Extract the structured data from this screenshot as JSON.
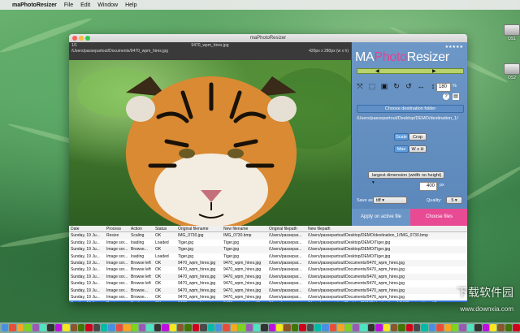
{
  "menubar": {
    "app": "maPhotoResizer",
    "items": [
      "File",
      "Edit",
      "Window",
      "Help"
    ]
  },
  "desktop": {
    "icons": [
      "OS1",
      "OS2"
    ]
  },
  "window": {
    "title": "maPhotoResizer",
    "info": {
      "count": "1/1",
      "path": "/Users/passepartout/Documents/9470_wpm_hires.jpg",
      "filename": "9470_wpm_hires.jpg",
      "dims": "420px x 280px (w x h)"
    },
    "logo": {
      "prefix": "MA",
      "brand": "Photo",
      "suffix": "Resizer"
    },
    "stars": "★★★★★",
    "zoom": "180",
    "zoom_unit": "%",
    "choose_dest_label": "Choose destination folder",
    "dest_path": "/Users/passepartout/Desktop/DEMO/destination_1/",
    "scale_label": "Scale",
    "crop_label": "Crop",
    "max_label": "Max",
    "wxh_label": "W x H",
    "dimension_select": "largest dimension (width no height)",
    "dimension_value": "400",
    "dimension_unit": "px",
    "save_as_label": "Save as:",
    "save_as_value": "tiff",
    "quality_label": "Quality:",
    "quality_value": "5",
    "apply_label": "Apply on active file",
    "choose_files_label": "Choose files"
  },
  "table": {
    "headers": [
      "Date",
      "Process",
      "Action",
      "Status",
      "Original filename",
      "New filename",
      "Original filepath",
      "New filepath"
    ],
    "rows": [
      [
        "Sunday, 19 Ju...",
        "Resize",
        "Scaling",
        "OK",
        "IMG_0730.jpg",
        "IMG_0730.bmp",
        "/Users/passepar...",
        "/Users/passepartout/Desktop/DEMO/destination_1/IMG_0730.bmp"
      ],
      [
        "Sunday, 19 Ju...",
        "Image sor...",
        "loading",
        "Loaded",
        "Tiger.jpg",
        "Tiger.jpg",
        "/Users/passepar...",
        "/Users/passepartout/Desktop/DEMO/Tiger.jpg"
      ],
      [
        "Sunday, 19 Ju...",
        "Image sor...",
        "Browse...",
        "OK",
        "Tiger.jpg",
        "Tiger.jpg",
        "/Users/passepar...",
        "/Users/passepartout/Desktop/DEMO/Tiger.jpg"
      ],
      [
        "Sunday, 19 Ju...",
        "Image sor...",
        "loading",
        "Loaded",
        "Tiger.jpg",
        "Tiger.jpg",
        "/Users/passepar...",
        "/Users/passepartout/Desktop/DEMO/Tiger.jpg"
      ],
      [
        "Sunday, 19 Ju...",
        "Image sor...",
        "Browse left",
        "OK",
        "9470_wpm_hires.jpg",
        "9470_wpm_hires.jpg",
        "/Users/passepar...",
        "/Users/passepartout/Documents/9470_wpm_hires.jpg"
      ],
      [
        "Sunday, 19 Ju...",
        "Image sor...",
        "Browse left",
        "OK",
        "9470_wpm_hires.jpg",
        "9470_wpm_hires.jpg",
        "/Users/passepar...",
        "/Users/passepartout/Documents/9470_wpm_hires.jpg"
      ],
      [
        "Sunday, 19 Ju...",
        "Image sor...",
        "Browse left",
        "OK",
        "9470_wpm_hires.jpg",
        "9470_wpm_hires.jpg",
        "/Users/passepar...",
        "/Users/passepartout/Documents/9470_wpm_hires.jpg"
      ],
      [
        "Sunday, 19 Ju...",
        "Image sor...",
        "Browse left",
        "OK",
        "9470_wpm_hires.jpg",
        "9470_wpm_hires.jpg",
        "/Users/passepar...",
        "/Users/passepartout/Documents/9470_wpm_hires.jpg"
      ],
      [
        "Sunday, 19 Ju...",
        "Image sor...",
        "Browse...",
        "OK",
        "9470_wpm_hires.jpg",
        "9470_wpm_hires.jpg",
        "/Users/passepar...",
        "/Users/passepartout/Documents/9470_wpm_hires.jpg"
      ],
      [
        "Sunday, 19 Ju...",
        "Image sor...",
        "Browse...",
        "OK",
        "9470_wpm_hires.jpg",
        "9470_wpm_hires.jpg",
        "/Users/passepar...",
        "/Users/passepartout/Documents/9470_wpm_hires.jpg"
      ],
      [
        "Sunday, 19 Ju...",
        "Resize",
        "Scaling",
        "OK",
        "9470_wpm_hires.jpg",
        "9470_wpm_hires.tiff",
        "/Users/passepar...",
        "/Users/passepartout/Desktop/DEMO/destination_1/9470_wpm_hires.tiff"
      ]
    ],
    "selected_index": 10
  },
  "watermark": {
    "line1": "下载软件园",
    "line2": "www.downxia.com"
  },
  "colors": {
    "panel": "#5a86ba",
    "accent_pink": "#e84a94",
    "selection": "#2e6fd3",
    "slider": "#b7d36a"
  }
}
